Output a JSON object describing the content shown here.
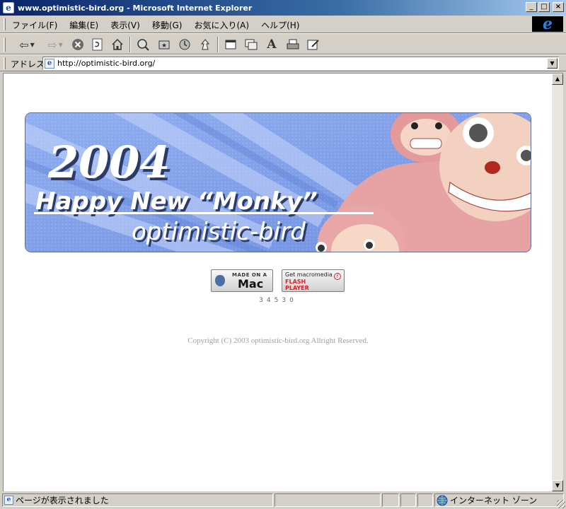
{
  "window": {
    "title": "www.optimistic-bird.org - Microsoft Internet Explorer",
    "app_icon": "ie-page-icon",
    "controls": {
      "minimize": "_",
      "maximize": "□",
      "close": "×"
    }
  },
  "menu": {
    "items": [
      "ファイル(F)",
      "編集(E)",
      "表示(V)",
      "移動(G)",
      "お気に入り(A)",
      "ヘルプ(H)"
    ]
  },
  "toolbar": {
    "buttons": [
      "back-icon",
      "forward-icon",
      "stop-icon",
      "refresh-icon",
      "home-icon",
      "search-icon",
      "favorites-icon",
      "history-icon",
      "channels-icon",
      "fullscreen-icon",
      "mail-icon",
      "font-icon",
      "print-icon",
      "edit-icon"
    ]
  },
  "address": {
    "label": "アドレス",
    "url": "http://optimistic-bird.org/"
  },
  "page": {
    "banner": {
      "year": "2004",
      "headline": "Happy New “Monky”",
      "site": "optimistic-bird"
    },
    "badges": {
      "mac_small": "MADE ON A",
      "mac_big": "Mac",
      "flash_small": "Get macromedia",
      "flash_line1": "FLASH",
      "flash_line2": "PLAYER"
    },
    "counter": "34530",
    "copyright": "Copyright (C) 2003 optimistic-bird.org Allright Reserved."
  },
  "status": {
    "text": "ページが表示されました",
    "zone": "インターネット ゾーン"
  },
  "colors": {
    "titlebar_start": "#0a246a",
    "titlebar_end": "#a6caf0",
    "chrome": "#d4d0c8",
    "banner_blue": "#7f9ee8",
    "monkey_pink": "#e8a0a0",
    "copyright_gray": "#a0a0a0"
  }
}
